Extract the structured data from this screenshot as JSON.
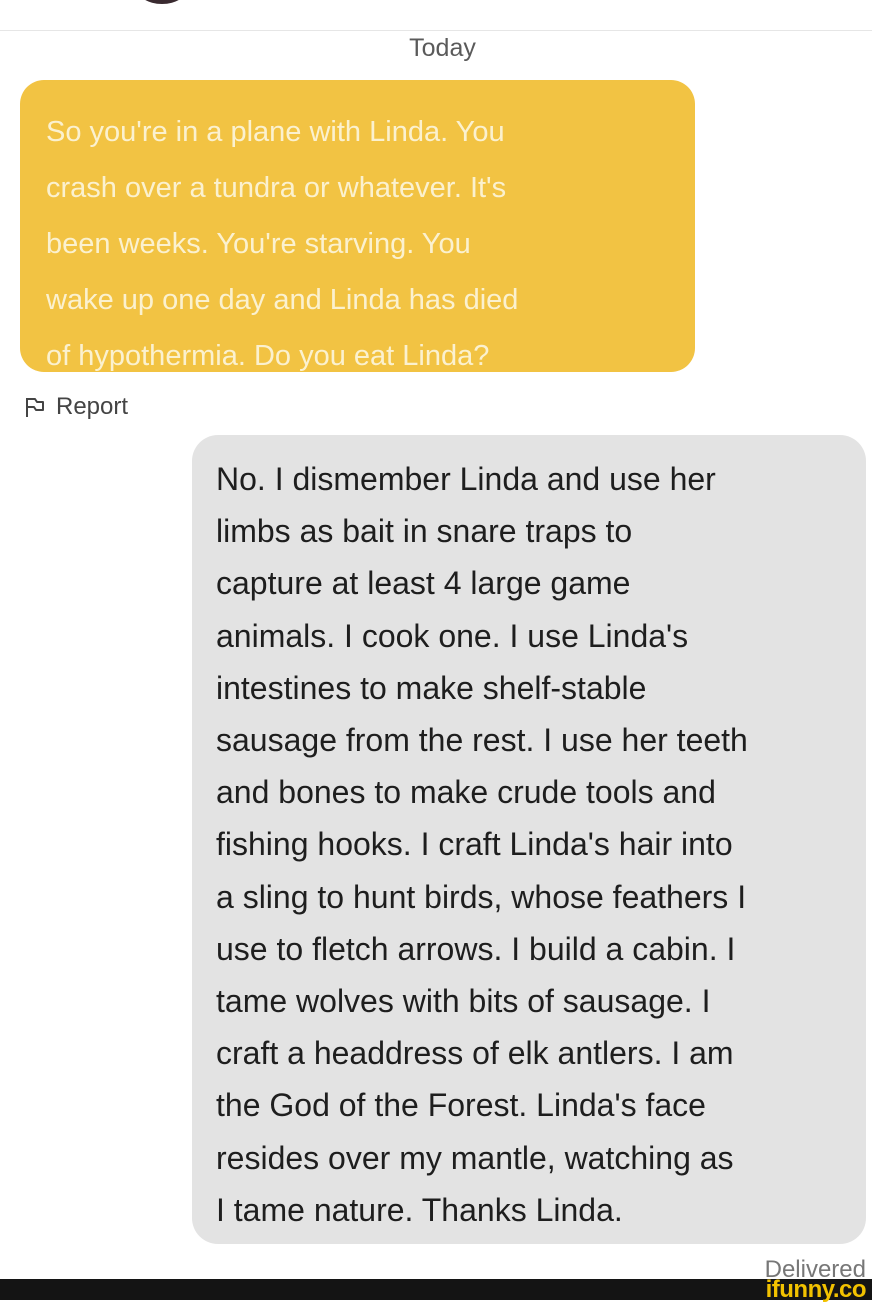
{
  "conversation": {
    "date_label": "Today",
    "sent_message": "So you're in a plane with Linda. You\ncrash over a tundra or whatever. It's\nbeen weeks. You're starving. You\nwake up one day and Linda has died\nof hypothermia. Do you eat Linda?",
    "report_label": "Report",
    "received_message": "No. I dismember Linda and use her\nlimbs as bait in snare traps to\ncapture at least 4 large game\nanimals. I cook one. I use Linda's\nintestines to make shelf-stable\nsausage from the rest. I use her teeth\nand bones to make crude tools and\nfishing hooks. I craft Linda's hair into\na sling to hunt birds, whose feathers I\nuse to fletch arrows. I build a cabin. I\ntame wolves with bits of sausage. I\ncraft a headdress of elk antlers. I am\nthe God of the Forest. Linda's face\nresides over my mantle, watching as\nI tame nature. Thanks Linda.",
    "status": "Delivered"
  },
  "watermark": "ifunny.co",
  "icons": {
    "report": "flag-icon"
  },
  "colors": {
    "sent_bubble": "#f2c343",
    "received_bubble": "#e3e3e3",
    "watermark": "#f2c200"
  }
}
